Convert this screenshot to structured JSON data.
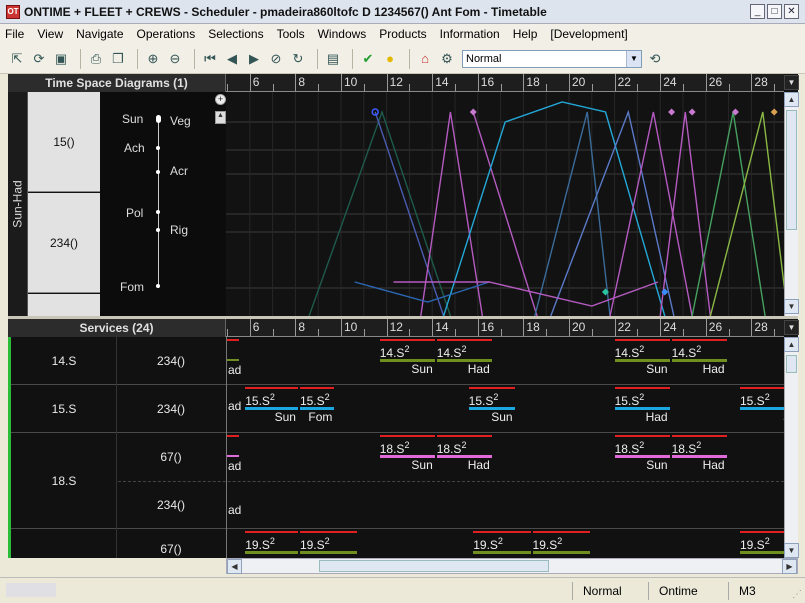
{
  "window": {
    "title": "ONTIME + FLEET + CREWS - Scheduler - pmadeira860ltofc D 1234567() Ant Fom - Timetable",
    "app_icon": "app-logo-icon"
  },
  "menu": [
    "File",
    "View",
    "Navigate",
    "Operations",
    "Selections",
    "Tools",
    "Windows",
    "Products",
    "Information",
    "Help",
    "[Development]"
  ],
  "toolbar": {
    "mode_select": "Normal"
  },
  "tsd": {
    "header": "Time Space Diagrams (1)",
    "ruler_labels": [
      "6",
      "8",
      "10",
      "12",
      "14",
      "16",
      "18",
      "20",
      "22",
      "24",
      "26",
      "28"
    ],
    "groups": [
      {
        "label": "15()"
      },
      {
        "label": "234()"
      }
    ],
    "side_label": "Sun-Had",
    "stations_left": [
      "Sun",
      "Ach",
      "Pol",
      "Fom"
    ],
    "stations_right": [
      "Veg",
      "Acr",
      "Rig"
    ]
  },
  "services": {
    "header": "Services (24)",
    "ruler_labels": [
      "6",
      "8",
      "10",
      "12",
      "14",
      "16",
      "18",
      "20",
      "22",
      "24",
      "26",
      "28"
    ],
    "rows": [
      {
        "service": "14.S",
        "vehicles": [
          "234()"
        ]
      },
      {
        "service": "15.S",
        "vehicles": [
          "234()"
        ]
      },
      {
        "service": "18.S",
        "vehicles": [
          "67()",
          "234()"
        ]
      },
      {
        "service": "",
        "vehicles": [
          "67()"
        ]
      }
    ],
    "trips": [
      {
        "row": 0,
        "name": "14.S",
        "sup": "2",
        "dest": "Sun",
        "color": "#6f8f1f"
      },
      {
        "row": 0,
        "name": "14.S",
        "sup": "2",
        "dest": "Had",
        "color": "#6f8f1f"
      },
      {
        "row": 0,
        "name": "14.S",
        "sup": "2",
        "dest": "Sun",
        "color": "#6f8f1f"
      },
      {
        "row": 0,
        "name": "14.S",
        "sup": "2",
        "dest": "Had",
        "color": "#6f8f1f"
      },
      {
        "row": 1,
        "name": "15.S",
        "sup": "2",
        "dest": "Sun",
        "color": "#1ba7e0"
      },
      {
        "row": 1,
        "name": "15.S",
        "sup": "2",
        "dest": "Fom",
        "color": "#1ba7e0"
      },
      {
        "row": 1,
        "name": "15.S",
        "sup": "2",
        "dest": "Sun",
        "color": "#1ba7e0"
      },
      {
        "row": 1,
        "name": "15.S",
        "sup": "2",
        "dest": "Had",
        "color": "#1ba7e0"
      },
      {
        "row": 1,
        "name": "15.S",
        "sup": "2",
        "dest": "Sun",
        "color": "#1ba7e0"
      },
      {
        "row": 2,
        "name": "18.S",
        "sup": "2",
        "dest": "Sun",
        "color": "#e06ad8"
      },
      {
        "row": 2,
        "name": "18.S",
        "sup": "2",
        "dest": "Had",
        "color": "#e06ad8"
      },
      {
        "row": 2,
        "name": "18.S",
        "sup": "2",
        "dest": "Sun",
        "color": "#e06ad8"
      },
      {
        "row": 2,
        "name": "18.S",
        "sup": "2",
        "dest": "Had",
        "color": "#e06ad8"
      },
      {
        "row": 3,
        "name": "19.S",
        "sup": "2",
        "dest": "",
        "color": "#6f8f1f"
      },
      {
        "row": 3,
        "name": "19.S",
        "sup": "2",
        "dest": "",
        "color": "#6f8f1f"
      },
      {
        "row": 3,
        "name": "19.S",
        "sup": "2",
        "dest": "",
        "color": "#6f8f1f"
      },
      {
        "row": 3,
        "name": "19.S",
        "sup": "2",
        "dest": "",
        "color": "#6f8f1f"
      },
      {
        "row": 3,
        "name": "19.S",
        "sup": "2",
        "dest": "",
        "color": "#6f8f1f"
      }
    ],
    "clipped_labels": [
      "ad",
      "ad",
      "ad",
      "ad",
      "ad"
    ]
  },
  "status": {
    "mode": "Normal",
    "product": "Ontime",
    "code": "M3"
  },
  "colors": {
    "pane_bg": "#131313",
    "accent_green": "#2bbd3a",
    "red_bar": "#e02020"
  }
}
